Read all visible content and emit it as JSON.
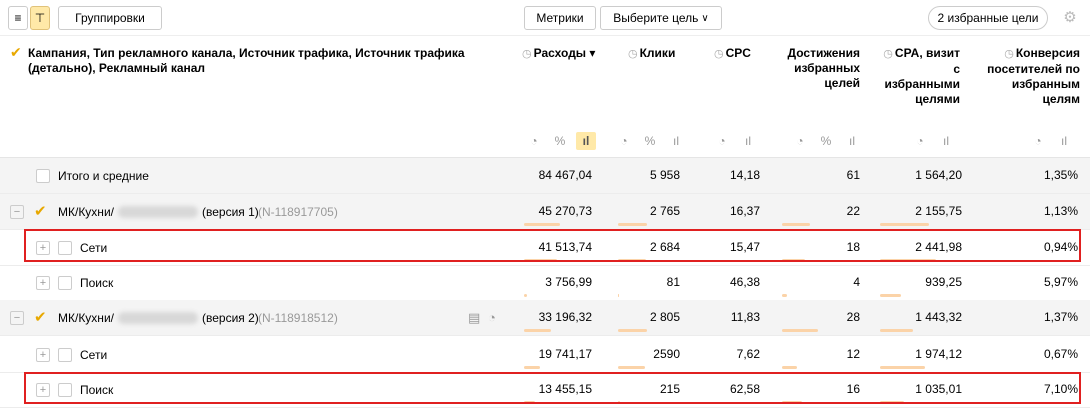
{
  "toolbar": {
    "list_icon": "≡",
    "tree_icon": "⊤",
    "groupings": "Группировки",
    "metrics": "Метрики",
    "goal": "Выберите цель",
    "fav_goals": "2 избранные цели",
    "settings_icon": "gear-icon"
  },
  "header": {
    "grouping_title": "Кампания, Тип рекламного канала, Источник трафика, Источник трафика (детально), Рекламный канал",
    "cols": {
      "spend": "Расходы",
      "clicks": "Клики",
      "cpc": "CPC",
      "goals": "Достижения избранных целей",
      "cpa": "CPA, визит с избранными целями",
      "conv": "Конверсия посетителей по избранным целям"
    }
  },
  "rows": [
    {
      "label": "Итого и средние",
      "spend": "84 467,04",
      "clicks": "5 958",
      "cpc": "14,18",
      "goals": "61",
      "cpa": "1 564,20",
      "conv": "1,35%"
    },
    {
      "label": "МК/Кухни/",
      "suffix": "(версия 1)",
      "id": "(N-118917705)",
      "spend": "45 270,73",
      "clicks": "2 765",
      "cpc": "16,37",
      "goals": "22",
      "cpa": "2 155,75",
      "conv": "1,13%"
    },
    {
      "label": "Сети",
      "spend": "41 513,74",
      "clicks": "2 684",
      "cpc": "15,47",
      "goals": "18",
      "cpa": "2 441,98",
      "conv": "0,94%"
    },
    {
      "label": "Поиск",
      "spend": "3 756,99",
      "clicks": "81",
      "cpc": "46,38",
      "goals": "4",
      "cpa": "939,25",
      "conv": "5,97%"
    },
    {
      "label": "МК/Кухни/",
      "suffix": "(версия 2)",
      "id": "(N-118918512)",
      "spend": "33 196,32",
      "clicks": "2 805",
      "cpc": "11,83",
      "goals": "28",
      "cpa": "1 443,32",
      "conv": "1,37%"
    },
    {
      "label": "Сети",
      "spend": "19 741,17",
      "clicks": "2590",
      "cpc": "7,62",
      "goals": "12",
      "cpa": "1 974,12",
      "conv": "0,67%"
    },
    {
      "label": "Поиск",
      "spend": "13 455,15",
      "clicks": "215",
      "cpc": "62,58",
      "goals": "16",
      "cpa": "1 035,01",
      "conv": "7,10%"
    }
  ],
  "share": {
    "spend": [
      1,
      0.536,
      0.491,
      0.044,
      0.393,
      0.234,
      0.159
    ],
    "clicks": [
      1,
      0.464,
      0.45,
      0.014,
      0.471,
      0.435,
      0.036
    ],
    "goals": [
      1,
      0.361,
      0.295,
      0.066,
      0.459,
      0.197,
      0.262
    ],
    "cpa": [
      1,
      0.6,
      0.68,
      0.26,
      0.4,
      0.55,
      0.29
    ]
  }
}
